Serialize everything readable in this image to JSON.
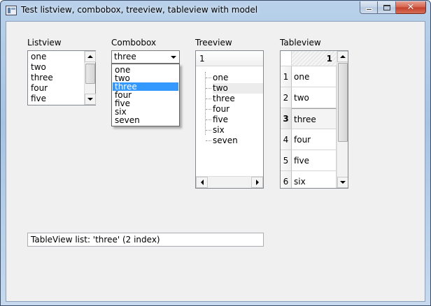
{
  "window": {
    "title": "Test listview, combobox, treeview, tableview with model",
    "minimize_label": "",
    "maximize_label": "",
    "close_label": "✕"
  },
  "listview": {
    "label": "Listview",
    "items": [
      "one",
      "two",
      "three",
      "four",
      "five"
    ]
  },
  "combobox": {
    "label": "Combobox",
    "value": "three",
    "options": [
      "one",
      "two",
      "three",
      "four",
      "five",
      "six",
      "seven"
    ],
    "selected_index": 2
  },
  "treeview": {
    "label": "Treeview",
    "header": "1",
    "items": [
      "one",
      "two",
      "three",
      "four",
      "five",
      "six",
      "seven"
    ]
  },
  "tableview": {
    "label": "Tableview",
    "column_header": "1",
    "row_headers": [
      "1",
      "2",
      "3",
      "4",
      "5",
      "6"
    ],
    "cells": [
      "one",
      "two",
      "three",
      "four",
      "five",
      "six"
    ],
    "current_row": 2
  },
  "status": {
    "text": "TableView list: 'three' (2 index)"
  },
  "colors": {
    "selection": "#3399ff",
    "client_bg": "#f0f0f0"
  }
}
